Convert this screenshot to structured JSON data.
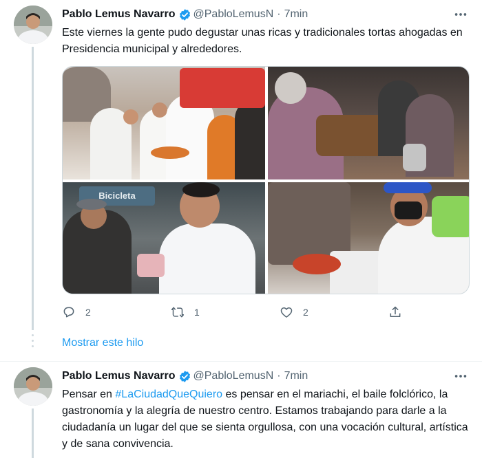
{
  "tweet1": {
    "author_name": "Pablo Lemus Navarro",
    "handle": "@PabloLemusN",
    "separator": "·",
    "time": "7min",
    "text": "Este viernes la gente pudo degustar unas ricas y tradicionales tortas ahogadas en Presidencia municipal y alrededores.",
    "photo_sign_text": "Bicicleta",
    "actions": {
      "reply_count": "2",
      "retweet_count": "1",
      "like_count": "2"
    },
    "icons": [
      "verified-icon",
      "more-icon",
      "reply-icon",
      "retweet-icon",
      "like-icon",
      "share-icon"
    ]
  },
  "show_thread_label": "Mostrar este hilo",
  "tweet2": {
    "author_name": "Pablo Lemus Navarro",
    "handle": "@PabloLemusN",
    "separator": "·",
    "time": "7min",
    "text_before": "Pensar en ",
    "hashtag": "#LaCiudadQueQuiero",
    "text_after": " es pensar en el mariachi, el baile folclórico, la gastronomía y la alegría de nuestro centro. Estamos trabajando para darle a la ciudadanía un lugar del que se sienta orgullosa, con una vocación cultural, artística y de sana convivencia."
  },
  "colors": {
    "accent": "#1d9bf0",
    "text": "#0f1419",
    "secondary": "#536471",
    "line": "#cfd9de"
  }
}
